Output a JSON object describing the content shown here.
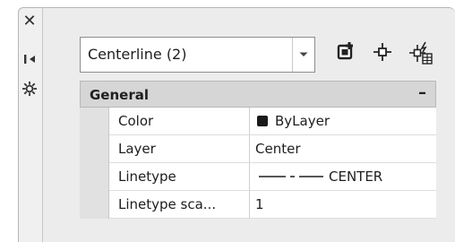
{
  "left_strip": {
    "icons": [
      "close-icon",
      "auto-hide-icon",
      "properties-options-icon"
    ]
  },
  "object_selector": {
    "value": "Centerline (2)"
  },
  "toolbar": {
    "icons": [
      "toggle-pickadd-icon",
      "select-objects-icon",
      "quick-select-icon"
    ]
  },
  "section": {
    "title": "General",
    "toggle": "–"
  },
  "properties": [
    {
      "name": "Color",
      "value": "ByLayer",
      "swatch": "#1a1a1a"
    },
    {
      "name": "Layer",
      "value": "Center"
    },
    {
      "name": "Linetype",
      "value": "CENTER"
    },
    {
      "name": "Linetype sca...",
      "value": "1"
    }
  ]
}
